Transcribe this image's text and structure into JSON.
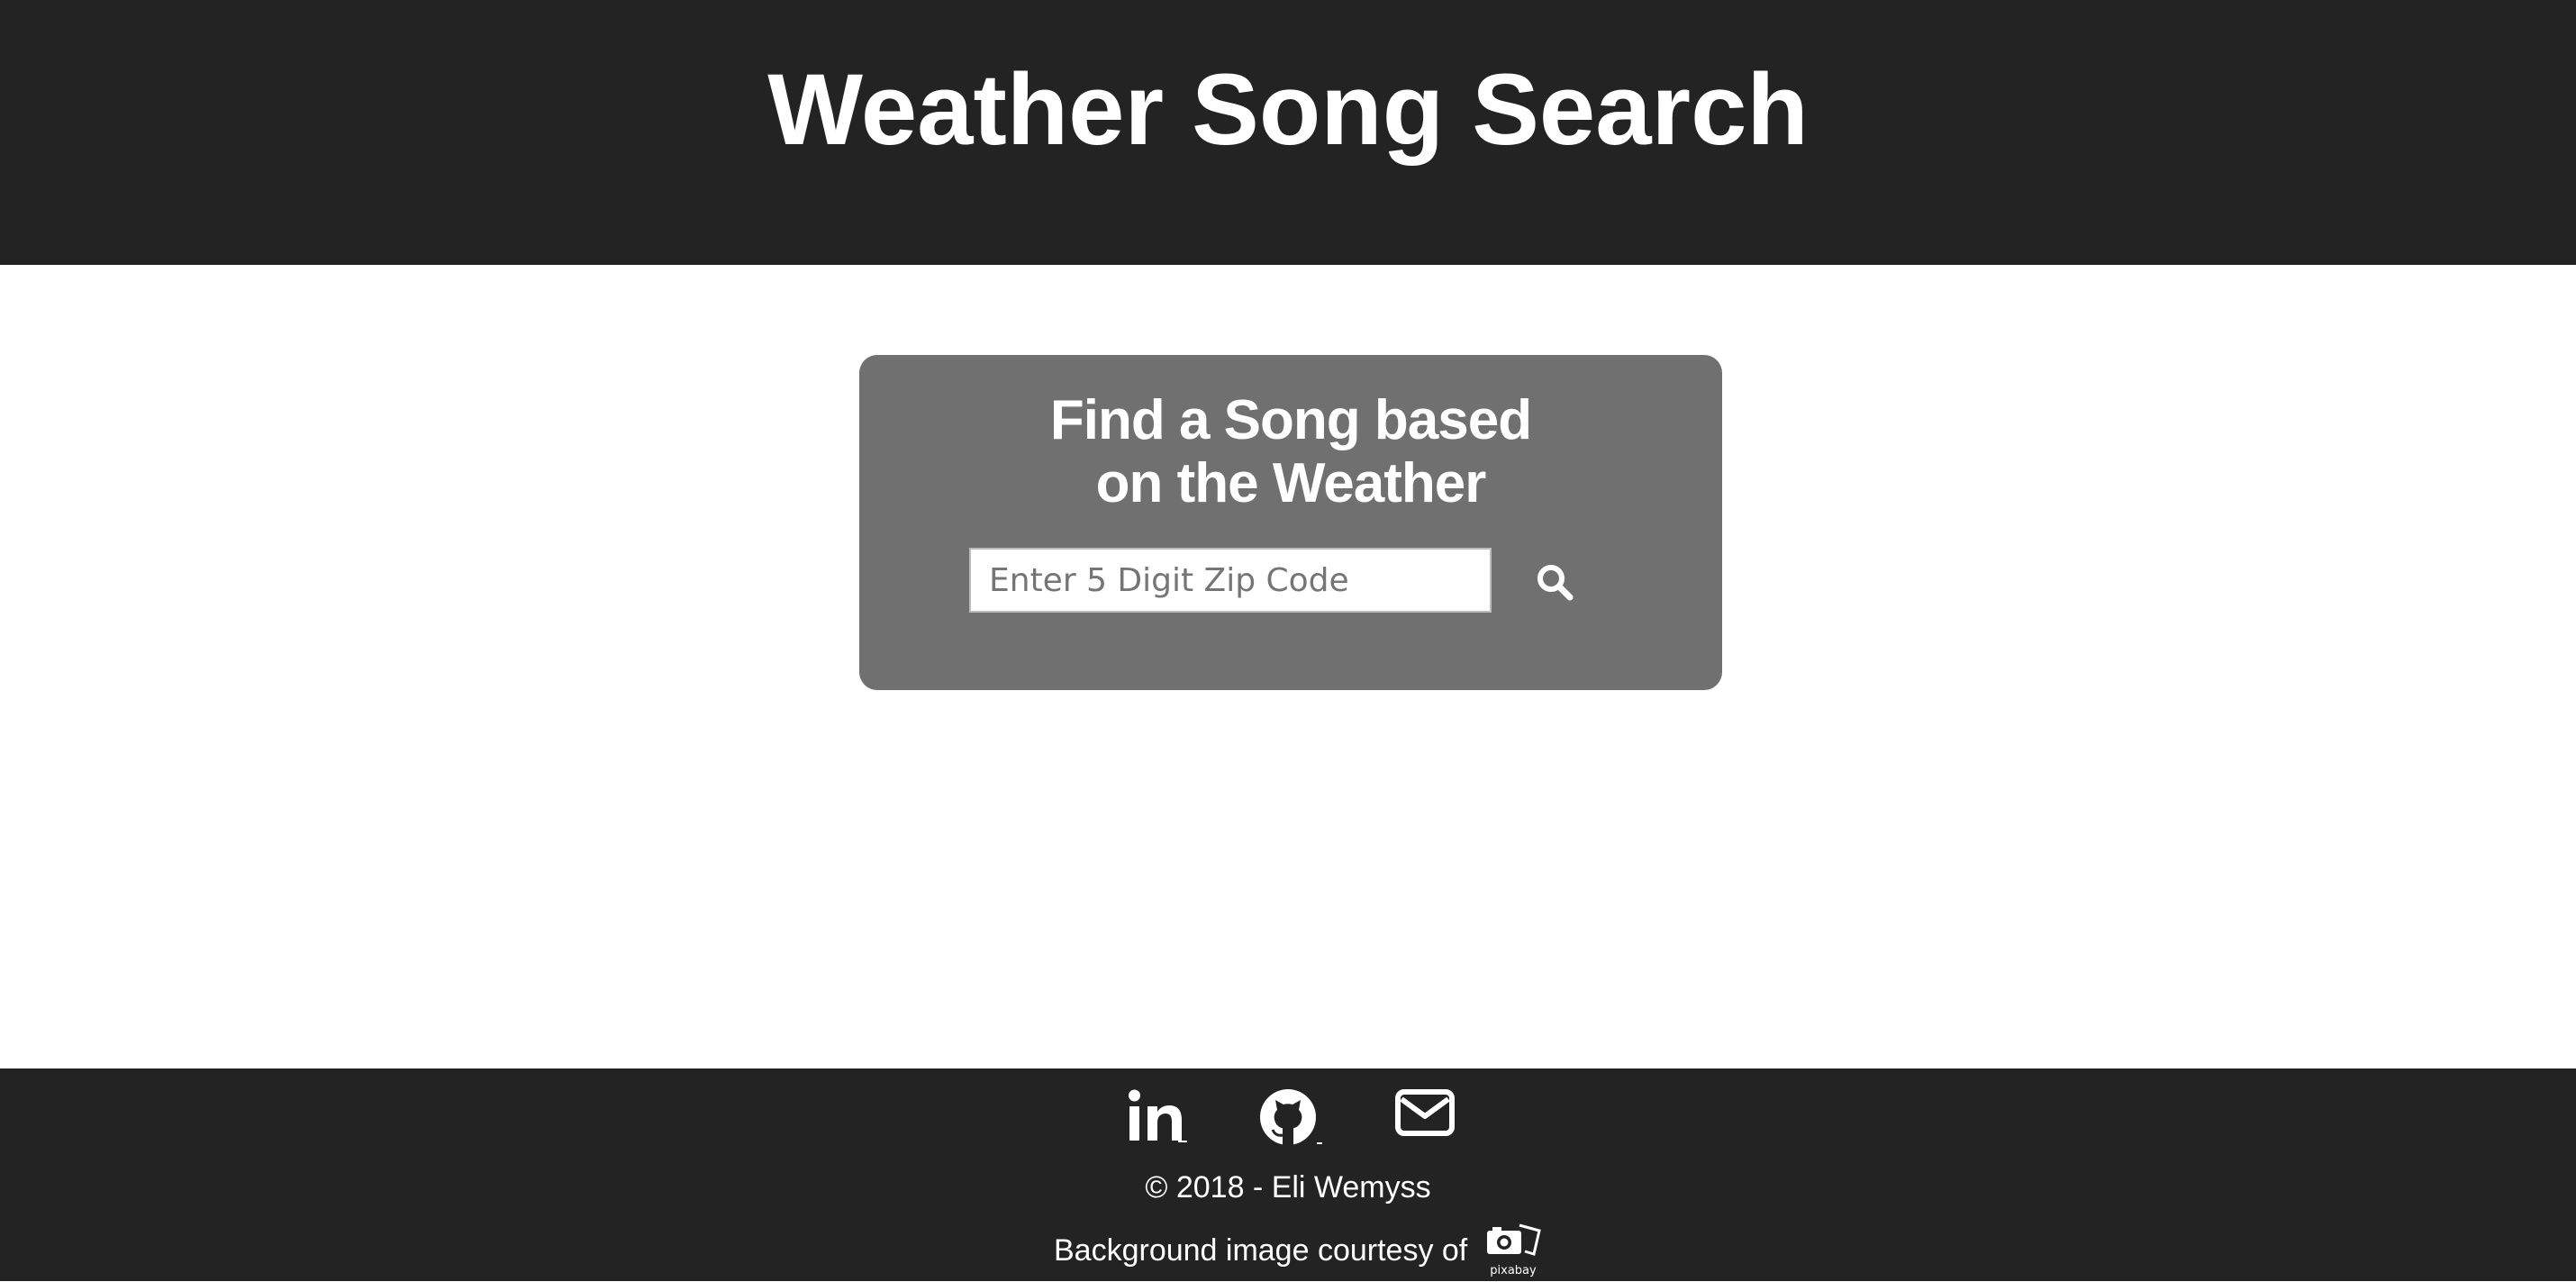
{
  "header": {
    "title": "Weather Song Search"
  },
  "search_card": {
    "heading": "Find a Song based on the Weather",
    "zip_placeholder": "Enter 5 Digit Zip Code",
    "zip_value": "",
    "search_icon": "search-icon"
  },
  "footer": {
    "social": [
      {
        "icon": "linkedin-icon"
      },
      {
        "icon": "github-icon"
      },
      {
        "icon": "envelope-icon"
      }
    ],
    "copyright": "© 2018 - Eli Wemyss",
    "credit_text": "Background image courtesy of",
    "credit_logo": "pixabay-logo",
    "credit_logo_text": "pixabay"
  },
  "colors": {
    "header_bg": "#232323",
    "card_bg": "#707070",
    "text": "#ffffff"
  }
}
